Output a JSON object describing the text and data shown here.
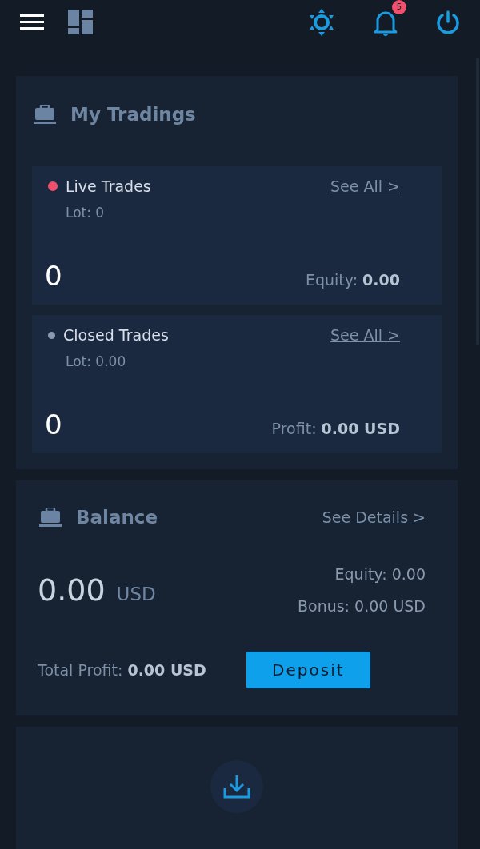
{
  "topbar": {
    "notifications": "5"
  },
  "tradings": {
    "title": "My Tradings",
    "items": [
      {
        "name": "Live Trades",
        "color": "#f0506e",
        "link": "See All >",
        "lot": "Lot: 0",
        "count": "0",
        "stat": "Equity: **0.00**"
      },
      {
        "name": "Closed Trades",
        "color": "#8a9bb0",
        "link": "See All >",
        "lot": "Lot: 0.00",
        "count": "0",
        "stat": "Profit: **0.00 USD**"
      }
    ]
  },
  "balance": {
    "title": "Balance",
    "link": "See Details >",
    "amount": "0.00",
    "currency": "USD",
    "equity": "Equity: 0.00",
    "bonus": "Bonus: 0.00 USD",
    "total_profit": "Total Profit: **0.00 USD**",
    "button": "Deposit"
  }
}
